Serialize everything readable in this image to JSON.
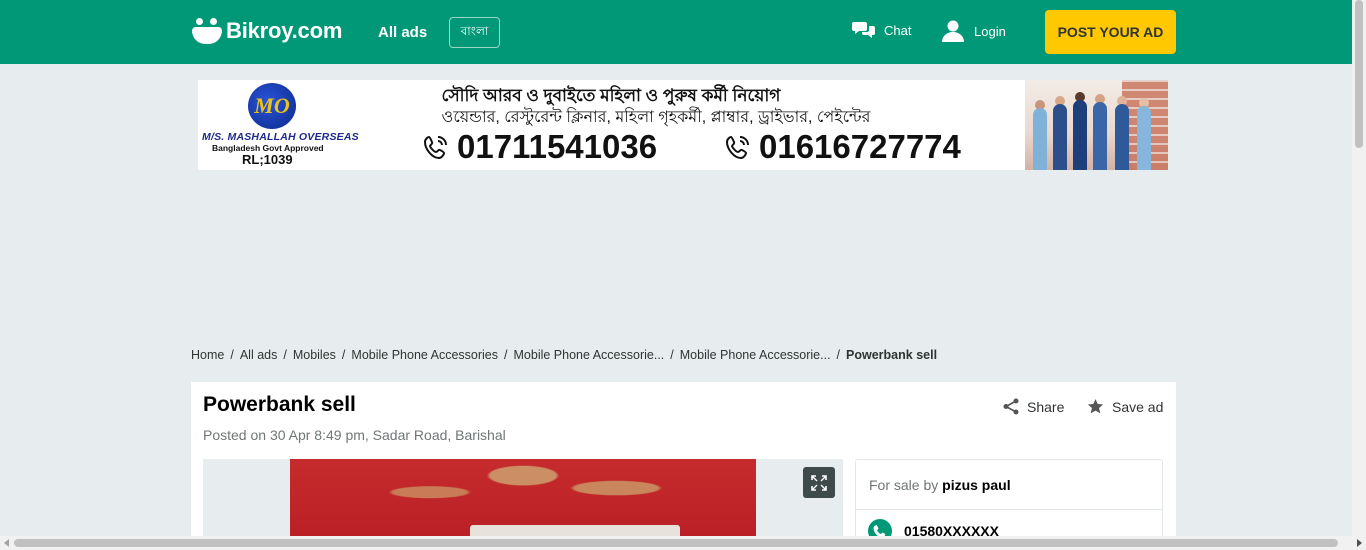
{
  "header": {
    "logo_text": "Bikroy.com",
    "all_ads_label": "All ads",
    "language_label": "বাংলা",
    "chat_label": "Chat",
    "login_label": "Login",
    "post_ad_label": "POST YOUR AD",
    "brand_color": "#009877",
    "post_button_color": "#ffc800"
  },
  "banner": {
    "logo_letters": "MO",
    "company": "M/S. MASHALLAH OVERSEAS",
    "approval": "Bangladesh  Govt Approved",
    "license": "RL;1039",
    "line1": "সৌদি আরব ও দুবাইতে মহিলা ও পুরুষ কর্মী নিয়োগ",
    "line2": "ওয়েন্ডার, রেস্টুরেন্ট ক্লিনার, মহিলা গৃহকর্মী, প্লাম্বার, ড্রাইভার, পেইন্টের",
    "phone1": "01711541036",
    "phone2": "01616727774"
  },
  "breadcrumb": {
    "items": [
      "Home",
      "All ads",
      "Mobiles",
      "Mobile Phone Accessories",
      "Mobile Phone Accessorie...",
      "Mobile Phone Accessorie..."
    ],
    "current": "Powerbank sell",
    "separator": "/"
  },
  "ad": {
    "title": "Powerbank sell",
    "posted": "Posted on 30 Apr 8:49 pm, Sadar Road, Barishal",
    "share_label": "Share",
    "save_label": "Save ad"
  },
  "seller": {
    "prefix": "For sale by",
    "name": "pizus paul",
    "phone": "01580XXXXXX"
  }
}
